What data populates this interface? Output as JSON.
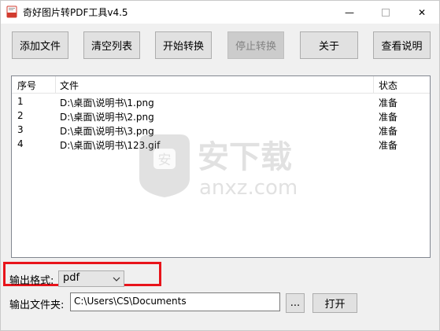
{
  "window": {
    "title": "奇好图片转PDF工具v4.5",
    "min_glyph": "—",
    "close_glyph": "✕"
  },
  "toolbar": {
    "add_files": "添加文件",
    "clear_list": "清空列表",
    "start_convert": "开始转换",
    "stop_convert": "停止转换",
    "about": "关于",
    "view_help": "查看说明"
  },
  "file_list": {
    "columns": [
      "序号",
      "文件",
      "状态"
    ],
    "rows": [
      {
        "index": "1",
        "file": "D:\\桌面\\说明书\\1.png",
        "status": "准备"
      },
      {
        "index": "2",
        "file": "D:\\桌面\\说明书\\2.png",
        "status": "准备"
      },
      {
        "index": "3",
        "file": "D:\\桌面\\说明书\\3.png",
        "status": "准备"
      },
      {
        "index": "4",
        "file": "D:\\桌面\\说明书\\123.gif",
        "status": "准备"
      }
    ]
  },
  "watermark": {
    "brand": "安下载",
    "domain": "anxz.com",
    "icon_glyph": "安"
  },
  "output": {
    "format_label": "输出格式:",
    "format_value": "pdf",
    "folder_label": "输出文件夹:",
    "folder_value": "C:\\Users\\CS\\Documents",
    "browse_label": "...",
    "open_label": "打开"
  },
  "colors": {
    "highlight_border": "#e8141b",
    "window_bg": "#f0f0f0",
    "button_bg": "#e1e1e1",
    "disabled_bg": "#cccccc"
  },
  "icons": {
    "app_icon": "pdf-app-icon",
    "minimize": "minimize-icon",
    "maximize": "maximize-icon",
    "close": "close-icon",
    "dropdown": "chevron-down-icon"
  }
}
